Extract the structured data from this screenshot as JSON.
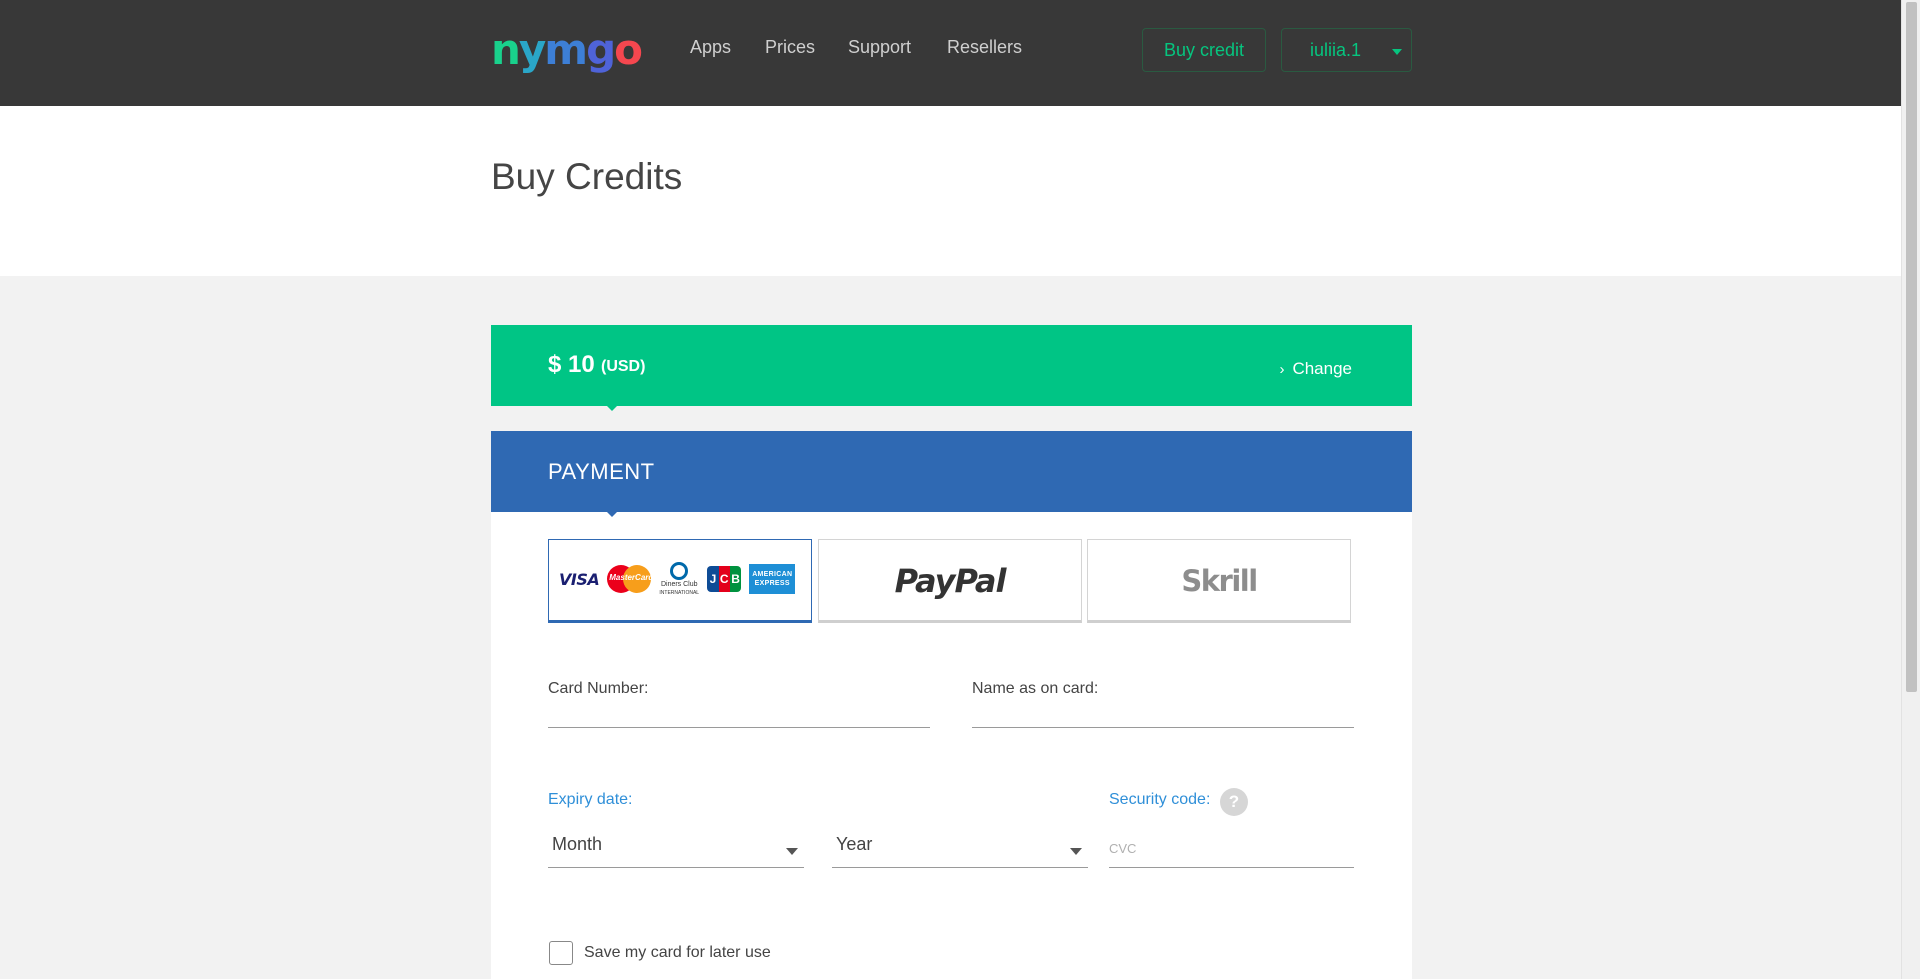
{
  "header": {
    "logo": {
      "letters": [
        "n",
        "y",
        "m",
        "g",
        "o"
      ],
      "colors": [
        "#19d18c",
        "#2aa6c8",
        "#3d7fd6",
        "#4f63d8",
        "#f5474f"
      ]
    },
    "nav": [
      "Apps",
      "Prices",
      "Support",
      "Resellers"
    ],
    "buy_credit_label": "Buy credit",
    "username": "iuliia.1"
  },
  "page": {
    "title": "Buy Credits"
  },
  "amount": {
    "symbol": "$",
    "value": "10",
    "currency": "(USD)",
    "change_label": "Change"
  },
  "payment": {
    "title": "PAYMENT",
    "methods": {
      "cards": {
        "visa": "VISA",
        "mastercard": "MasterCard",
        "diners": "Diners Club",
        "diners_sub": "INTERNATIONAL",
        "jcb": [
          "J",
          "C",
          "B"
        ],
        "amex": [
          "AMERICAN",
          "EXPRESS"
        ]
      },
      "paypal": "PayPal",
      "skrill": "Skrill"
    },
    "fields": {
      "card_number_label": "Card Number:",
      "name_label": "Name as on card:",
      "expiry_label": "Expiry date:",
      "month_value": "Month",
      "year_value": "Year",
      "security_label": "Security code:",
      "help_symbol": "?",
      "cvc_placeholder": "CVC",
      "save_card_label": "Save my card for later use"
    }
  },
  "colors": {
    "topbar": "#383838",
    "accent_green": "#00c585",
    "payment_blue": "#2f69b3",
    "label_blue": "#2f8fd8"
  }
}
